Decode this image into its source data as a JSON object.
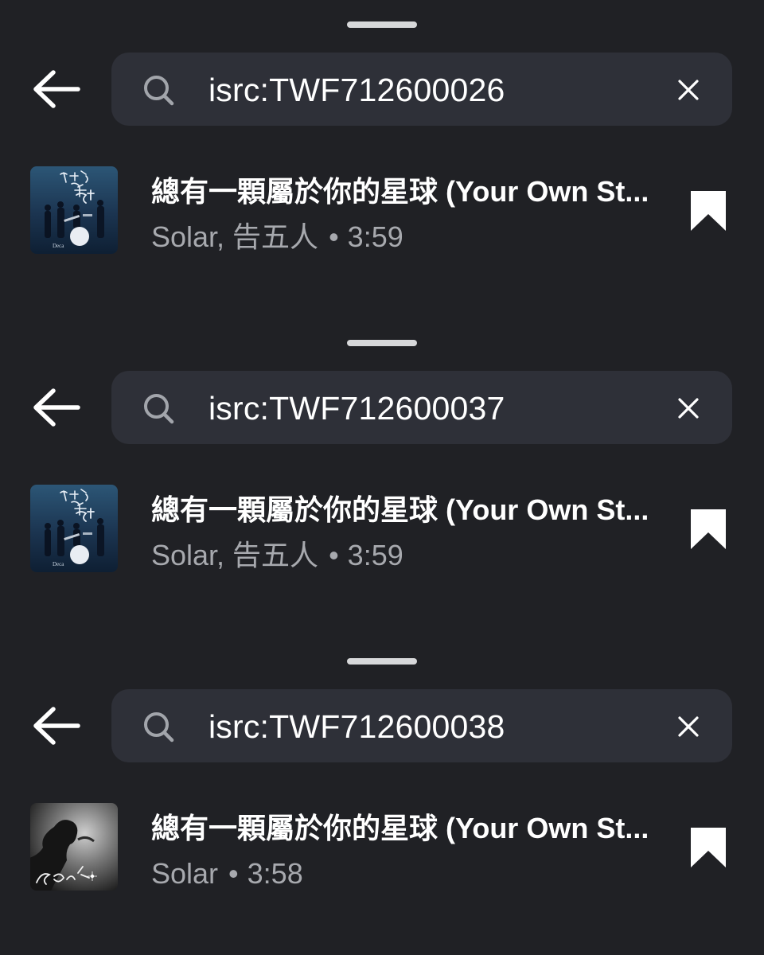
{
  "panels": [
    {
      "search": {
        "value": "isrc:TWF712600026"
      },
      "results": [
        {
          "title": "總有一顆屬於你的星球 (Your Own St...",
          "artist": "Solar, 告五人",
          "separator": "•",
          "duration": "3:59"
        }
      ]
    },
    {
      "search": {
        "value": "isrc:TWF712600037"
      },
      "results": [
        {
          "title": "總有一顆屬於你的星球 (Your Own St...",
          "artist": "Solar, 告五人",
          "separator": "•",
          "duration": "3:59"
        }
      ]
    },
    {
      "search": {
        "value": "isrc:TWF712600038"
      },
      "results": [
        {
          "title": "總有一顆屬於你的星球 (Your Own St...",
          "artist": "Solar",
          "separator": "•",
          "duration": "3:58"
        }
      ]
    }
  ],
  "icons": {
    "back": "arrow-left-icon",
    "search": "search-icon",
    "clear": "close-icon",
    "bookmark": "bookmark-icon"
  },
  "colors": {
    "background": "#202125",
    "search_field": "#2e3038",
    "primary_text": "#ffffff",
    "secondary_text": "#a7a9ae"
  }
}
